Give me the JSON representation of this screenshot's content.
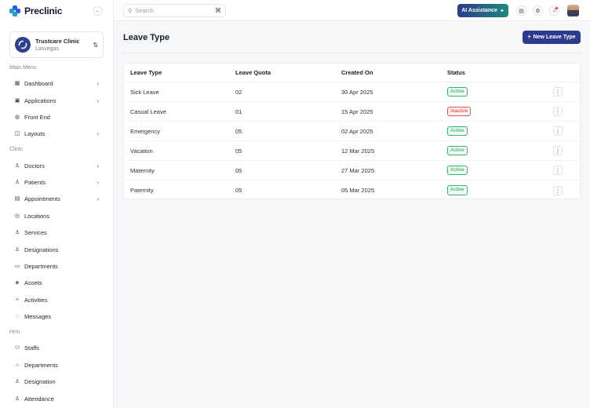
{
  "brand": {
    "name": "Preclinic",
    "collapse_icon": "arrow-left-icon"
  },
  "clinic": {
    "name": "Trustcare Clinic",
    "city": "Lasvegas",
    "switch_icon": "swap-vertical-icon"
  },
  "sidebar": {
    "sections": [
      {
        "label": "Main Menu"
      },
      {
        "label": "Clinic"
      },
      {
        "label": "Hrm"
      }
    ],
    "items": [
      {
        "label": "Dashboard",
        "icon": "grid-icon",
        "chevron": "›"
      },
      {
        "label": "Applications",
        "icon": "apps-icon",
        "chevron": "›"
      },
      {
        "label": "Front End",
        "icon": "globe-icon",
        "chevron": ""
      },
      {
        "label": "Layouts",
        "icon": "layout-icon",
        "chevron": "›"
      },
      {
        "label": "Doctors",
        "icon": "user-icon",
        "chevron": "›"
      },
      {
        "label": "Patients",
        "icon": "user-icon",
        "chevron": "›"
      },
      {
        "label": "Appointments",
        "icon": "calendar-icon",
        "chevron": "›"
      },
      {
        "label": "Locations",
        "icon": "map-pin-icon",
        "chevron": ""
      },
      {
        "label": "Services",
        "icon": "user-check-icon",
        "chevron": ""
      },
      {
        "label": "Designations",
        "icon": "user-star-icon",
        "chevron": ""
      },
      {
        "label": "Departments",
        "icon": "building-icon",
        "chevron": ""
      },
      {
        "label": "Assets",
        "icon": "assets-icon",
        "chevron": ""
      },
      {
        "label": "Activities",
        "icon": "activity-icon",
        "chevron": ""
      },
      {
        "label": "Messages",
        "icon": "message-icon",
        "chevron": ""
      },
      {
        "label": "Staffs",
        "icon": "users-icon",
        "chevron": ""
      },
      {
        "label": "Departments",
        "icon": "bank-icon",
        "chevron": ""
      },
      {
        "label": "Designation",
        "icon": "user-star-icon",
        "chevron": ""
      },
      {
        "label": "Attendance",
        "icon": "user-clock-icon",
        "chevron": ""
      }
    ]
  },
  "topbar": {
    "search_placeholder": "Search",
    "search_shortcut": "⌘",
    "ai_button": "AI Assistance",
    "icons": [
      "calendar-icon",
      "settings-icon",
      "bell-icon",
      "avatar"
    ]
  },
  "page": {
    "title": "Leave Type",
    "new_button": "New Leave Type"
  },
  "table": {
    "headers": [
      "Leave Type",
      "Leave Quota",
      "Created On",
      "Status"
    ],
    "rows": [
      {
        "type": "Sick Leave",
        "quota": "02",
        "created": "30 Apr 2025",
        "status": "Active"
      },
      {
        "type": "Casual Leave",
        "quota": "01",
        "created": "15 Apr 2025",
        "status": "Inactive"
      },
      {
        "type": "Emergency",
        "quota": "05",
        "created": "02 Apr 2025",
        "status": "Active"
      },
      {
        "type": "Vacation",
        "quota": "05",
        "created": "12 Mar 2025",
        "status": "Active"
      },
      {
        "type": "Maternity",
        "quota": "05",
        "created": "27 Mar 2025",
        "status": "Active"
      },
      {
        "type": "Paternity",
        "quota": "05",
        "created": "05 Mar 2025",
        "status": "Active"
      }
    ]
  },
  "colors": {
    "primary": "#2c3a8f",
    "active": "#1f9d55",
    "inactive": "#d93636",
    "logo_blue": "#2e5bd8",
    "logo_teal": "#1fa0c8"
  }
}
